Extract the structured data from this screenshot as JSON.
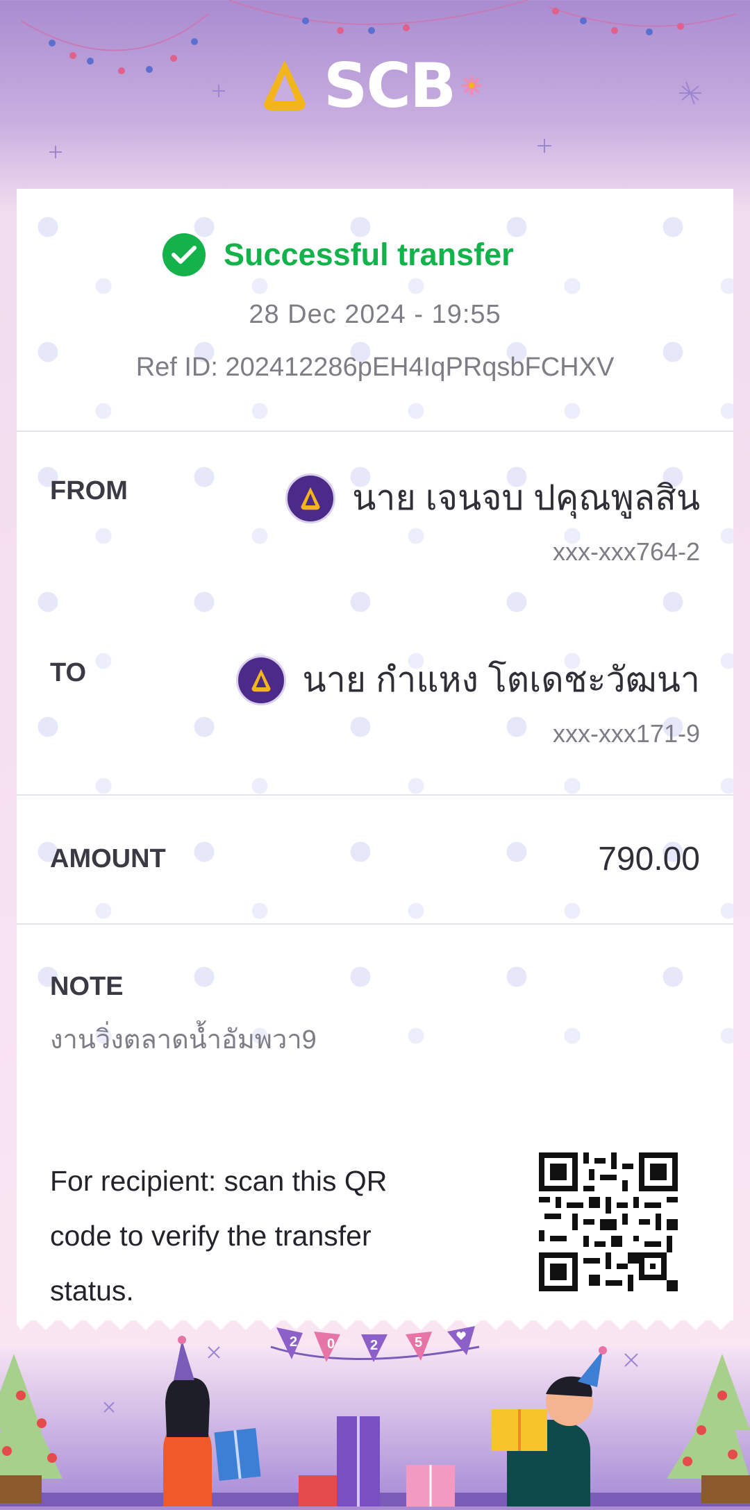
{
  "brand": {
    "name": "SCB",
    "primary": "#4b2a89",
    "gold": "#f2b51b",
    "success": "#13b24b"
  },
  "status": {
    "text": "Successful transfer",
    "icon": "check-circle-icon"
  },
  "datetime": "28  Dec  2024  -  19:55",
  "ref": {
    "label": "Ref  ID:",
    "value": "202412286pEH4IqPRqsbFCHXV"
  },
  "from": {
    "label": "FROM",
    "name": "นาย เจนจบ ปคุณพูลสิน",
    "account": "xxx-xxx764-2"
  },
  "to": {
    "label": "TO",
    "name": "นาย กำแหง โตเดชะวัฒนา",
    "account": "xxx-xxx171-9"
  },
  "amount": {
    "label": "AMOUNT",
    "value": "790.00"
  },
  "note": {
    "label": "NOTE",
    "value": "งานวิ่งตลาดน้ำอัมพวา9"
  },
  "qr": {
    "text": "For recipient: scan this QR code to verify the transfer status."
  },
  "footer": {
    "flags": [
      "2",
      "0",
      "2",
      "5"
    ]
  }
}
